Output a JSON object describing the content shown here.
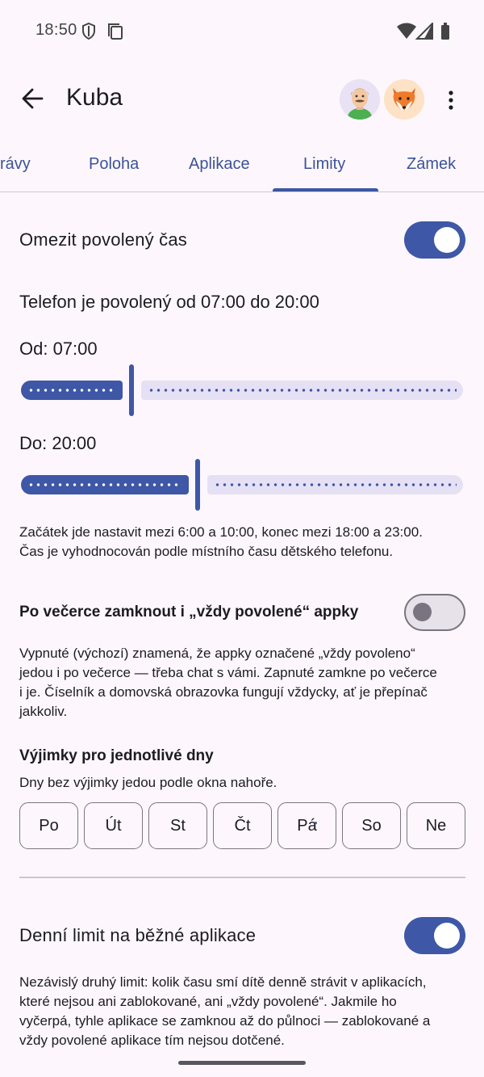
{
  "status_bar": {
    "time": "18:50"
  },
  "app_bar": {
    "title": "Kuba"
  },
  "tabs": [
    {
      "label": "Zprávy",
      "visible_text": "rávy"
    },
    {
      "label": "Poloha"
    },
    {
      "label": "Aplikace"
    },
    {
      "label": "Limity",
      "selected": true
    },
    {
      "label": "Zámek"
    }
  ],
  "allowed_time": {
    "title": "Omezit povolený čas",
    "enabled": true,
    "summary": "Telefon je povolený od 07:00 do 20:00",
    "from_label": "Od: 07:00",
    "from_fraction": 0.25,
    "to_label": "Do: 20:00",
    "to_fraction": 0.4,
    "hint_line1": "Začátek jde nastavit mezi 6:00 a 10:00, konec mezi 18:00 a 23:00.",
    "hint_line2": "Čas je vyhodnocován podle místního času dětského telefonu."
  },
  "lock_always_allowed": {
    "title": "Po večerce zamknout i „vždy povolené“ appky",
    "enabled": false,
    "desc_line1": "Vypnuté (výchozí) znamená, že appky označené „vždy povoleno“",
    "desc_line2": "jedou i po večerce — třeba chat s vámi. Zapnuté zamkne po večerce",
    "desc_line3": "i je. Číselník a domovská obrazovka fungují vždycky, ať je přepínač",
    "desc_line4": "jakkoliv."
  },
  "exceptions": {
    "title": "Výjimky pro jednotlivé dny",
    "subtitle": "Dny bez výjimky jedou podle okna nahoře.",
    "days": [
      "Po",
      "Út",
      "St",
      "Čt",
      "Pá",
      "So",
      "Ne"
    ]
  },
  "daily_limit": {
    "title": "Denní limit na běžné aplikace",
    "enabled": true,
    "desc_line1": "Nezávislý druhý limit: kolik času smí dítě denně strávit v aplikacích,",
    "desc_line2": "které nejsou ani zablokované, ani „vždy povolené“. Jakmile ho",
    "desc_line3": "vyčerpá, tyhle aplikace se zamknou až do půlnoci — zablokované a",
    "desc_line4": "vždy povolené aplikace tím nejsou dotčené."
  },
  "colors": {
    "accent": "#3e57a6",
    "tab_text": "#3c5397",
    "background": "#fdf7fd"
  },
  "icons": [
    "shield-icon",
    "copy-icon",
    "wifi-icon",
    "signal-icon",
    "battery-icon",
    "back-arrow-icon",
    "more-vert-icon"
  ]
}
